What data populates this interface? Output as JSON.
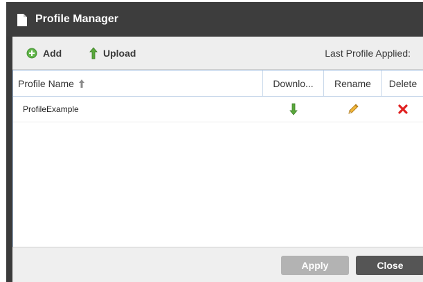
{
  "dialog": {
    "title": "Profile Manager",
    "title_icon": "document-icon"
  },
  "toolbar": {
    "add_label": "Add",
    "add_icon": "plus-circle-icon",
    "upload_label": "Upload",
    "upload_icon": "arrow-up-icon",
    "last_profile_label": "Last Profile Applied:"
  },
  "table": {
    "columns": {
      "name": "Profile Name",
      "download": "Downlo...",
      "rename": "Rename",
      "delete": "Delete"
    },
    "sort_icon": "sort-up-icon",
    "rows": [
      {
        "name": "ProfileExample",
        "download_icon": "download-arrow-icon",
        "rename_icon": "pencil-icon",
        "delete_icon": "red-x-icon"
      }
    ]
  },
  "footer": {
    "apply_label": "Apply",
    "close_label": "Close"
  },
  "colors": {
    "titlebar": "#3d3d3d",
    "header_border": "#a7c2e2",
    "apply_disabled": "#b3b3b3",
    "close": "#555555",
    "download_green": "#3f9a2c",
    "delete_red": "#e02020",
    "rename_orange": "#e5a22a"
  }
}
